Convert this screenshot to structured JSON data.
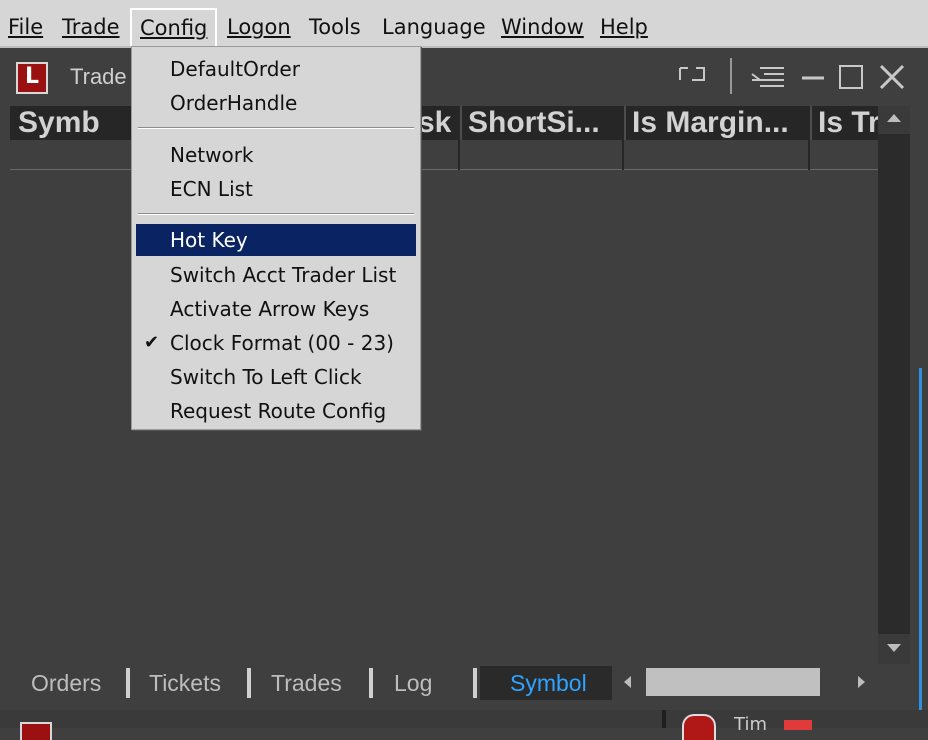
{
  "menubar": {
    "items": [
      {
        "label": "File",
        "underline": true
      },
      {
        "label": "Trade",
        "underline": true
      },
      {
        "label": "Config",
        "underline": true
      },
      {
        "label": "Logon",
        "underline": true
      },
      {
        "label": "Tools",
        "underline": false
      },
      {
        "label": "Language",
        "underline": false
      },
      {
        "label": "Window",
        "underline": true
      },
      {
        "label": "Help",
        "underline": true
      }
    ],
    "open_menu": "Config"
  },
  "window": {
    "logo_text": "L",
    "title": "Trade",
    "controls": [
      "restore-small-icon",
      "menu-lines-icon",
      "minimize-icon",
      "maximize-icon",
      "close-icon"
    ],
    "columns": [
      "Symb",
      "sk",
      "ShortSi...",
      "Is Margin...",
      "Is Tr"
    ]
  },
  "config_menu": {
    "items": [
      {
        "label": "DefaultOrder"
      },
      {
        "label": "OrderHandle"
      },
      {
        "separator": true
      },
      {
        "label": "Network"
      },
      {
        "label": "ECN List"
      },
      {
        "separator": true
      },
      {
        "label": "Hot Key",
        "highlighted": true
      },
      {
        "label": "Switch Acct Trader List"
      },
      {
        "label": "Activate Arrow Keys"
      },
      {
        "label": "Clock Format (00 - 23)",
        "checked": true
      },
      {
        "label": "Switch To Left Click"
      },
      {
        "label": "Request Route Config"
      }
    ],
    "check_glyph": "✔"
  },
  "tabs": {
    "items": [
      "Orders",
      "Tickets",
      "Trades",
      "Log",
      "Symbol"
    ],
    "active": "Symbol",
    "active_color": "#2ea3ff"
  },
  "bottom_strip": {
    "title": "Tim"
  },
  "colors": {
    "menu_highlight": "#0a2463",
    "brand_red": "#9b1111"
  }
}
